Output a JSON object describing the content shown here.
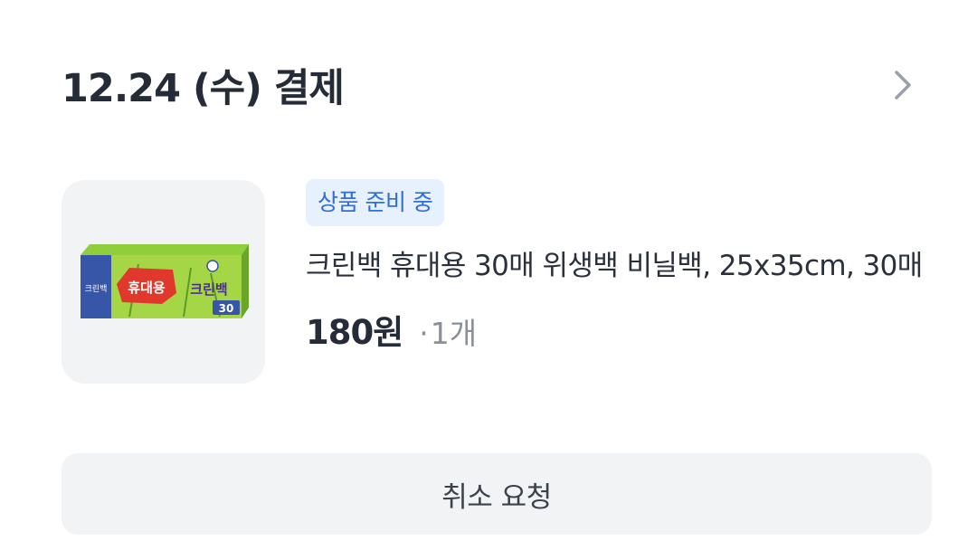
{
  "order": {
    "title": "12.24 (수) 결제"
  },
  "item": {
    "status_badge": "상품 준비 중",
    "product_name": "크린백 휴대용 30매 위생백 비닐백, 25x35cm, 30매",
    "price": "180원",
    "separator": "·",
    "quantity": "1개",
    "image": {
      "brand_text": "크린백",
      "label_text": "휴대용",
      "count_text": "30"
    }
  },
  "actions": {
    "cancel_label": "취소 요청"
  },
  "icons": {
    "header_chevron": "chevron-right-icon"
  },
  "colors": {
    "badge_bg": "#e7f0fd",
    "badge_text": "#2f6fd6",
    "button_bg": "#f2f3f5",
    "thumb_bg": "#f2f3f5"
  }
}
